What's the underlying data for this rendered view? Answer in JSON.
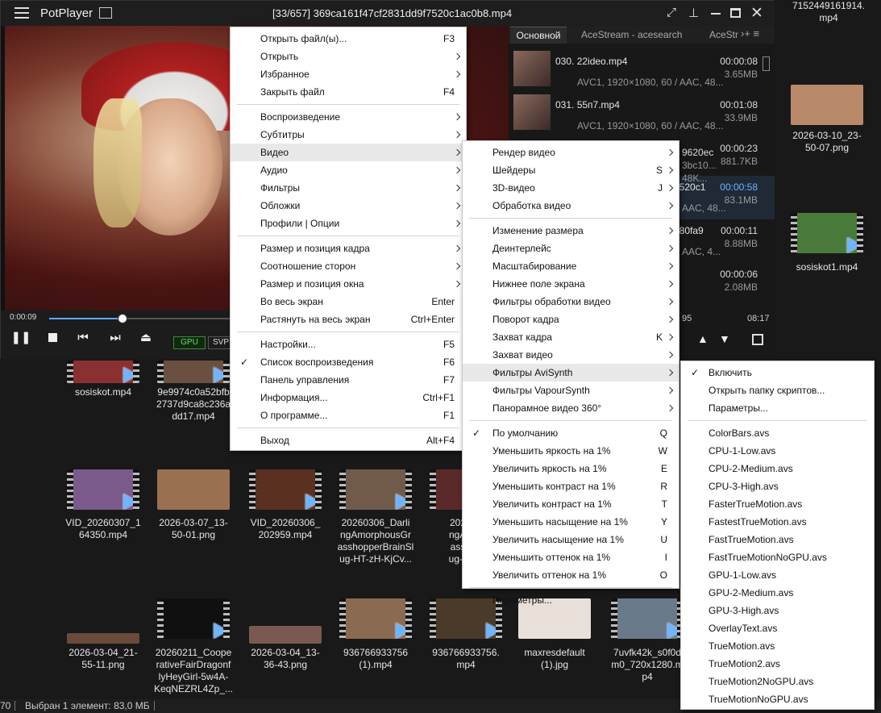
{
  "player": {
    "app_name": "PotPlayer",
    "title": "[33/657] 369ca161f47cf2831dd9f7520c1ac0b8.mp4",
    "time_elapsed": "0:00:09",
    "progress": 0.16,
    "gpu_label": "GPU",
    "svp_label": "SVP"
  },
  "playlist": {
    "tabs": [
      "Основной",
      "AceStream - acesearch",
      "AceStr"
    ],
    "items": [
      {
        "name": "030. 22ideo.mp4",
        "duration": "00:00:08",
        "info": "AVC1, 1920×1080, 60 / AAC, 48...",
        "size": "3.65MB"
      },
      {
        "name": "031. 55п7.mp4",
        "duration": "00:01:08",
        "info": "AVC1, 1920×1080, 60 / AAC, 48...",
        "size": "33.9MB"
      },
      {
        "name": "...",
        "duration": "00:00:23",
        "info": "",
        "size": "881.7KB"
      },
      {
        "name": "7520c1",
        "duration": "00:00:58",
        "info": "AAC, 48...",
        "size": "83.1MB"
      },
      {
        "name": "280fa9",
        "duration": "00:00:11",
        "info": "AAC, 4...",
        "size": "8.88MB"
      },
      {
        "name": "",
        "duration": "00:00:06",
        "info": "",
        "size": "2.08MB"
      }
    ],
    "partial_lines": [
      "9620ec",
      "3bc10...",
      "48K..."
    ],
    "footer_left": "95",
    "footer_right": "08:17"
  },
  "main_menu": [
    {
      "label": "Открыть файл(ы)...",
      "shortcut": "F3"
    },
    {
      "label": "Открыть",
      "sub": true
    },
    {
      "label": "Избранное",
      "sub": true
    },
    {
      "label": "Закрыть файл",
      "shortcut": "F4"
    },
    {
      "sep": true
    },
    {
      "label": "Воспроизведение",
      "sub": true
    },
    {
      "label": "Субтитры",
      "sub": true
    },
    {
      "label": "Видео",
      "sub": true,
      "hl": true
    },
    {
      "label": "Аудио",
      "sub": true
    },
    {
      "label": "Фильтры",
      "sub": true
    },
    {
      "label": "Обложки",
      "sub": true
    },
    {
      "label": "Профили | Опции",
      "sub": true
    },
    {
      "sep": true
    },
    {
      "label": "Размер и позиция кадра",
      "sub": true
    },
    {
      "label": "Соотношение сторон",
      "sub": true
    },
    {
      "label": "Размер и позиция окна",
      "sub": true
    },
    {
      "label": "Во весь экран",
      "shortcut": "Enter"
    },
    {
      "label": "Растянуть на весь экран",
      "shortcut": "Ctrl+Enter"
    },
    {
      "sep": true
    },
    {
      "label": "Настройки...",
      "shortcut": "F5"
    },
    {
      "label": "Список воспроизведения",
      "shortcut": "F6",
      "checked": true
    },
    {
      "label": "Панель управления",
      "shortcut": "F7"
    },
    {
      "label": "Информация...",
      "shortcut": "Ctrl+F1"
    },
    {
      "label": "О программе...",
      "shortcut": "F1"
    },
    {
      "sep": true
    },
    {
      "label": "Выход",
      "shortcut": "Alt+F4"
    }
  ],
  "video_menu": [
    {
      "label": "Рендер видео",
      "sub": true
    },
    {
      "label": "Шейдеры",
      "shortcut": "S",
      "sub": true
    },
    {
      "label": "3D-видео",
      "shortcut": "J",
      "sub": true
    },
    {
      "label": "Обработка видео",
      "sub": true
    },
    {
      "sep": true
    },
    {
      "label": "Изменение размера",
      "sub": true
    },
    {
      "label": "Деинтерлейс",
      "sub": true
    },
    {
      "label": "Масштабирование",
      "sub": true
    },
    {
      "label": "Нижнее поле экрана",
      "sub": true
    },
    {
      "label": "Фильтры обработки видео",
      "sub": true
    },
    {
      "label": "Поворот кадра",
      "sub": true
    },
    {
      "label": "Захват кадра",
      "shortcut": "K",
      "sub": true
    },
    {
      "label": "Захват видео",
      "sub": true
    },
    {
      "label": "Фильтры AviSynth",
      "sub": true,
      "hl": true
    },
    {
      "label": "Фильтры VapourSynth",
      "sub": true
    },
    {
      "label": "Панорамное видео 360°",
      "sub": true
    },
    {
      "sep": true
    },
    {
      "label": "По умолчанию",
      "shortcut": "Q",
      "checked": true
    },
    {
      "label": "Уменьшить яркость на 1%",
      "shortcut": "W"
    },
    {
      "label": "Увеличить яркость на 1%",
      "shortcut": "E"
    },
    {
      "label": "Уменьшить контраст на 1%",
      "shortcut": "R"
    },
    {
      "label": "Увеличить контраст на 1%",
      "shortcut": "T"
    },
    {
      "label": "Уменьшить насыщение на 1%",
      "shortcut": "Y"
    },
    {
      "label": "Увеличить насыщение на 1%",
      "shortcut": "U"
    },
    {
      "label": "Уменьшить оттенок на 1%",
      "shortcut": "I"
    },
    {
      "label": "Увеличить оттенок на 1%",
      "shortcut": "O"
    },
    {
      "sep": true
    },
    {
      "label": "Параметры..."
    }
  ],
  "avisynth_menu": [
    {
      "label": "Включить",
      "checked": true
    },
    {
      "label": "Открыть папку скриптов..."
    },
    {
      "label": "Параметры..."
    },
    {
      "sep": true
    },
    {
      "label": "ColorBars.avs"
    },
    {
      "label": "CPU-1-Low.avs"
    },
    {
      "label": "CPU-2-Medium.avs"
    },
    {
      "label": "CPU-3-High.avs"
    },
    {
      "label": "FasterTrueMotion.avs"
    },
    {
      "label": "FastestTrueMotion.avs"
    },
    {
      "label": "FastTrueMotion.avs"
    },
    {
      "label": "FastTrueMotionNoGPU.avs"
    },
    {
      "label": "GPU-1-Low.avs"
    },
    {
      "label": "GPU-2-Medium.avs"
    },
    {
      "label": "GPU-3-High.avs"
    },
    {
      "label": "OverlayText.avs"
    },
    {
      "label": "TrueMotion.avs"
    },
    {
      "label": "TrueMotion2.avs"
    },
    {
      "label": "TrueMotion2NoGPU.avs"
    },
    {
      "label": "TrueMotionNoGPU.avs"
    }
  ],
  "explorer": {
    "files": [
      {
        "name": "7152449161914.\nmp4",
        "color": "#3a3a3a"
      },
      {
        "name": "2026-03-10_23-\n50-07.png",
        "color": "#b88a6a"
      },
      {
        "name": "sosiskot1.mp4",
        "color": "#4a7a3a"
      },
      {
        "name": "sosiskot.mp4",
        "color": "#8a3030"
      },
      {
        "name": "9e9974c0a52bfb\n2737d9ca8c236a\ndd17.mp4",
        "color": "#6a5040"
      },
      {
        "name": "VID_20260307_1\n64350.mp4",
        "color": "#7a5a8a"
      },
      {
        "name": "2026-03-07_13-\n50-01.png",
        "color": "#9a7050"
      },
      {
        "name": "VID_20260306_\n202959.mp4",
        "color": "#5a3020"
      },
      {
        "name": "20260306_Darli\nngAmorphousGr\nasshopperBrainSl\nug-HT-zH-KjCv...",
        "color": "#705a4a"
      },
      {
        "name": "202603\nngAmor\nasshop\nug-HT-z",
        "color": "#5a2a2a"
      },
      {
        "name": "2026-03-04_21-\n55-11.png",
        "color": "#6a4a3a"
      },
      {
        "name": "20260211_Coope\nrativeFairDragonf\nlyHeyGirl-5w4A-\nKeqNEZRL4Zp_...",
        "color": "#101010"
      },
      {
        "name": "2026-03-04_13-\n36-43.png",
        "color": "#7a5a50"
      },
      {
        "name": "936766933756\n(1).mp4",
        "color": "#8a6a50"
      },
      {
        "name": "936766933756.\nmp4",
        "color": "#4a3a2a"
      },
      {
        "name": "maxresdefault\n(1).jpg",
        "color": "#e8e0d8"
      },
      {
        "name": "7uvfk42k_s0f0d\nm0_720x1280.m\np4",
        "color": "#6a7a8a"
      }
    ],
    "status_count": "70",
    "status_selected": "Выбран 1 элемент: 83,0 МБ"
  }
}
